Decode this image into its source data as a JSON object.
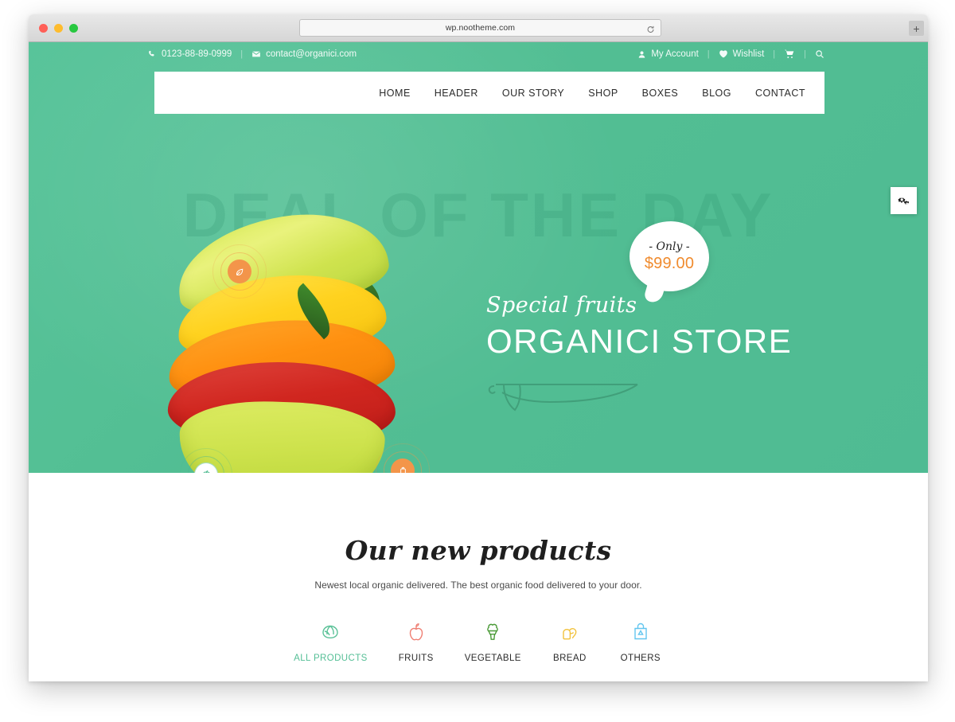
{
  "browser": {
    "url": "wp.nootheme.com",
    "reload_icon": "reload-icon",
    "new_tab_label": "+",
    "traffic_lights": [
      "close",
      "minimize",
      "maximize"
    ]
  },
  "topbar": {
    "phone": "0123-88-89-0999",
    "email": "contact@organici.com",
    "phone_icon": "phone-icon",
    "email_icon": "envelope-icon",
    "separator": "|",
    "account_label": "My Account",
    "account_icon": "user-icon",
    "wishlist_label": "Wishlist",
    "wishlist_icon": "heart-icon",
    "cart_icon": "shopping-cart-icon",
    "search_icon": "search-icon"
  },
  "nav": {
    "items": [
      {
        "label": "HOME"
      },
      {
        "label": "HEADER"
      },
      {
        "label": "OUR STORY"
      },
      {
        "label": "SHOP"
      },
      {
        "label": "BOXES"
      },
      {
        "label": "BLOG"
      },
      {
        "label": "CONTACT"
      }
    ]
  },
  "hero": {
    "watermark": "DEAL OF THE DAY",
    "script_text": "Special fruits",
    "title": "ORGANICI STORE",
    "ornament_icon": "leaf-ornament-icon",
    "bubble": {
      "only_label": "- Only -",
      "price": "$99.00",
      "price_color": "#f08b2e"
    },
    "hotspots": [
      {
        "name": "hotspot-leaf",
        "icon": "leaf-icon",
        "style": "orange"
      },
      {
        "name": "hotspot-apple",
        "icon": "apple-icon",
        "style": "green"
      },
      {
        "name": "hotspot-drink",
        "icon": "drink-icon",
        "style": "orange"
      }
    ],
    "background_color": "#52be93"
  },
  "settings": {
    "icon": "gears-icon"
  },
  "products": {
    "title": "Our new products",
    "subtitle": "Newest local organic delivered. The best organic food delivered to your door.",
    "categories": [
      {
        "label": "ALL PRODUCTS",
        "icon": "lettuce-icon",
        "color": "#5ac197",
        "active": true
      },
      {
        "label": "FRUITS",
        "icon": "apple-icon",
        "color": "#ef7f73",
        "active": false
      },
      {
        "label": "VEGETABLE",
        "icon": "broccoli-icon",
        "color": "#4a9a37",
        "active": false
      },
      {
        "label": "BREAD",
        "icon": "bread-icon",
        "color": "#f2c23c",
        "active": false
      },
      {
        "label": "OTHERS",
        "icon": "bag-icon",
        "color": "#63c6ef",
        "active": false
      }
    ]
  }
}
